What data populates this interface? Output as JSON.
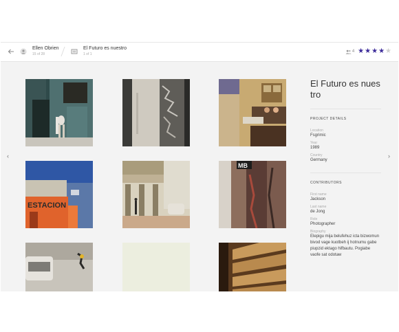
{
  "header": {
    "back_icon": "arrow-left-icon",
    "user": {
      "icon": "user-icon",
      "name": "Ellen Obrien",
      "sub": "15 of 28"
    },
    "gallery": {
      "icon": "gallery-icon",
      "name": "El Futuro es nuestro",
      "sub": "1 of 1"
    },
    "contributors_count": "4",
    "rating": {
      "value": 4,
      "max": 5
    },
    "accent_color": "#3b2a99"
  },
  "photos": [
    {
      "alt": "street scene with two people walking past green wall"
    },
    {
      "alt": "weathered wall with graffiti"
    },
    {
      "alt": "balcony with people and hanging laundry"
    },
    {
      "alt": "ESTACION building under blue sky"
    },
    {
      "alt": "colonnade street with vintage car"
    },
    {
      "alt": "rusty red metal door with MB sign"
    },
    {
      "alt": "aerial view of car and person"
    },
    {
      "alt": "pale sky"
    },
    {
      "alt": "building facade balconies"
    }
  ],
  "photo_texts": {
    "estacion": "ESTACION",
    "mb": "MB"
  },
  "details": {
    "title": "El Futuro es nuestro",
    "project_heading": "PROJECT DETAILS",
    "location_label": "Location",
    "location": "Fsgrimic",
    "year_label": "Year",
    "year": "1989",
    "country_label": "Country",
    "country": "Germany",
    "contributors_heading": "CONTRIBUTORS",
    "first_name_label": "First name",
    "first_name": "Jackson",
    "last_name_label": "Last name",
    "last_name": "de Jong",
    "role_label": "Role",
    "role": "Photographer",
    "biography_label": "Biography",
    "biography": "Elepigu mija belufehuz icta bizwomun bivod vage kuotbeh ij hotnumu gabe piupzid ektago hifbautu. Pogiabe vaofe sat odotaw"
  }
}
